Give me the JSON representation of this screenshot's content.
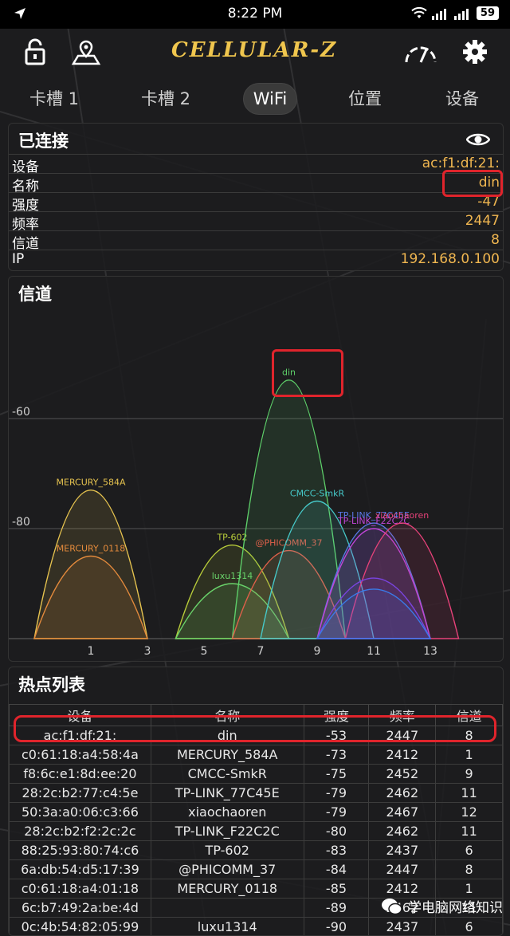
{
  "status_bar": {
    "time": "8:22 PM",
    "battery": "59"
  },
  "app": {
    "brand": "CELLULAR-Z"
  },
  "tabs": [
    {
      "label": "卡槽 1",
      "active": false
    },
    {
      "label": "卡槽 2",
      "active": false
    },
    {
      "label": "WiFi",
      "active": true
    },
    {
      "label": "位置",
      "active": false
    },
    {
      "label": "设备",
      "active": false
    }
  ],
  "connected": {
    "title": "已连接",
    "rows": [
      {
        "key": "设备",
        "value": "ac:f1:df:21:"
      },
      {
        "key": "名称",
        "value": "din"
      },
      {
        "key": "强度",
        "value": "-47"
      },
      {
        "key": "频率",
        "value": "2447"
      },
      {
        "key": "信道",
        "value": "8"
      },
      {
        "key": "IP",
        "value": "192.168.0.100"
      }
    ]
  },
  "channel_panel": {
    "title": "信道"
  },
  "chart_data": {
    "type": "area",
    "title": "信道",
    "xlabel": "",
    "ylabel": "",
    "x_ticks": [
      1,
      3,
      5,
      7,
      9,
      11,
      13
    ],
    "y_ticks": [
      -60,
      -80
    ],
    "xlim": [
      -1,
      15
    ],
    "ylim": [
      -100,
      -40
    ],
    "grid": true,
    "series": [
      {
        "name": "MERCURY_584A",
        "channel": 1,
        "signal": -73,
        "color": "#e6c34f"
      },
      {
        "name": "MERCURY_0118",
        "channel": 1,
        "signal": -85,
        "color": "#e38a3c"
      },
      {
        "name": "TP-602",
        "channel": 6,
        "signal": -83,
        "color": "#b8cc3a"
      },
      {
        "name": "luxu1314",
        "channel": 6,
        "signal": -90,
        "color": "#6ad36a"
      },
      {
        "name": "din",
        "channel": 8,
        "signal": -53,
        "color": "#5ed06a"
      },
      {
        "name": "@PHICOMM_37",
        "channel": 8,
        "signal": -84,
        "color": "#e0604a"
      },
      {
        "name": "CMCC-SmkR",
        "channel": 9,
        "signal": -75,
        "color": "#46c9c9"
      },
      {
        "name": "TP-LINK_77C45E",
        "channel": 11,
        "signal": -79,
        "color": "#5a78e8"
      },
      {
        "name": "TP-LINK_F22C2C",
        "channel": 11,
        "signal": -80,
        "color": "#c245d8"
      },
      {
        "name": "xiaochaoren",
        "channel": 12,
        "signal": -79,
        "color": "#e8427a"
      },
      {
        "name": "",
        "channel": 11,
        "signal": -89,
        "color": "#7a44e0"
      },
      {
        "name": "",
        "channel": 11,
        "signal": -91,
        "color": "#3a7ae8"
      }
    ]
  },
  "hotspots": {
    "title": "热点列表",
    "headers": [
      "设备",
      "名称",
      "强度",
      "频率",
      "信道"
    ],
    "rows": [
      [
        "ac:f1:df:21:",
        "din",
        "-53",
        "2447",
        "8"
      ],
      [
        "c0:61:18:a4:58:4a",
        "MERCURY_584A",
        "-73",
        "2412",
        "1"
      ],
      [
        "f8:6c:e1:8d:ee:20",
        "CMCC-SmkR",
        "-75",
        "2452",
        "9"
      ],
      [
        "28:2c:b2:77:c4:5e",
        "TP-LINK_77C45E",
        "-79",
        "2462",
        "11"
      ],
      [
        "50:3a:a0:06:c3:66",
        "xiaochaoren",
        "-79",
        "2467",
        "12"
      ],
      [
        "28:2c:b2:f2:2c:2c",
        "TP-LINK_F22C2C",
        "-80",
        "2462",
        "11"
      ],
      [
        "88:25:93:80:74:c6",
        "TP-602",
        "-83",
        "2437",
        "6"
      ],
      [
        "6a:db:54:d5:17:39",
        "@PHICOMM_37",
        "-84",
        "2447",
        "8"
      ],
      [
        "c0:61:18:a4:01:18",
        "MERCURY_0118",
        "-85",
        "2412",
        "1"
      ],
      [
        "6c:b7:49:2a:be:4d",
        "",
        "-89",
        "2462",
        "11"
      ],
      [
        "0c:4b:54:82:05:99",
        "luxu1314",
        "-90",
        "2437",
        "6"
      ]
    ]
  },
  "watermark": {
    "text": "学电脑网络知识"
  }
}
